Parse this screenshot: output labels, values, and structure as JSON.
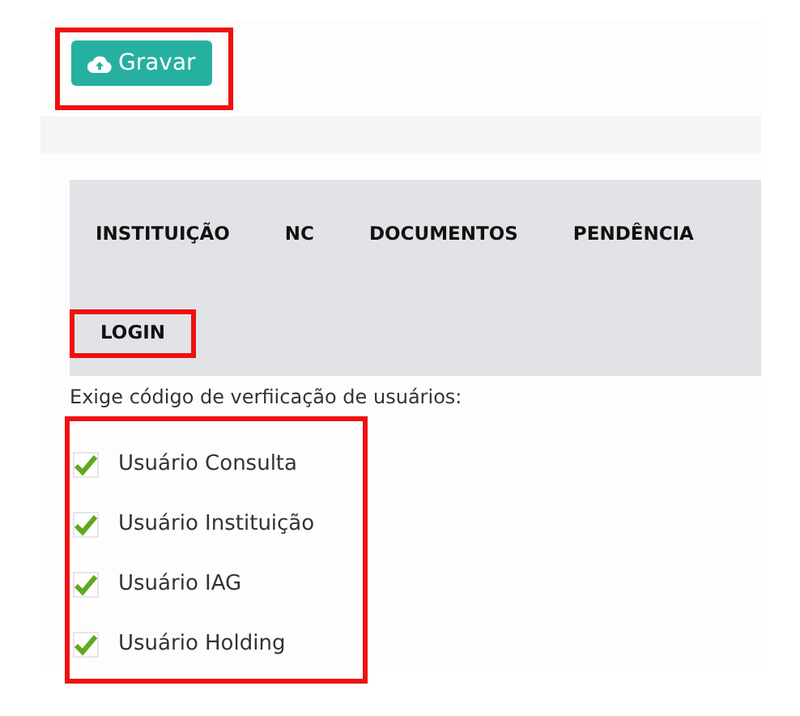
{
  "toolbar": {
    "save_button": {
      "label": "Gravar",
      "highlighted": true
    }
  },
  "tabs": [
    {
      "label": "INSTITUIÇÃO",
      "highlighted": false
    },
    {
      "label": "NC",
      "highlighted": false
    },
    {
      "label": "DOCUMENTOS",
      "highlighted": false
    },
    {
      "label": "PENDÊNCIA",
      "highlighted": false
    },
    {
      "label": "LOGIN",
      "highlighted": true
    }
  ],
  "settings": {
    "prompt": "Exige código de verfiicação de usuários:",
    "highlighted": true,
    "options": [
      {
        "label": "Usuário Consulta",
        "checked": true
      },
      {
        "label": "Usuário Instituição",
        "checked": true
      },
      {
        "label": "Usuário IAG",
        "checked": true
      },
      {
        "label": "Usuário Holding",
        "checked": true
      }
    ]
  }
}
